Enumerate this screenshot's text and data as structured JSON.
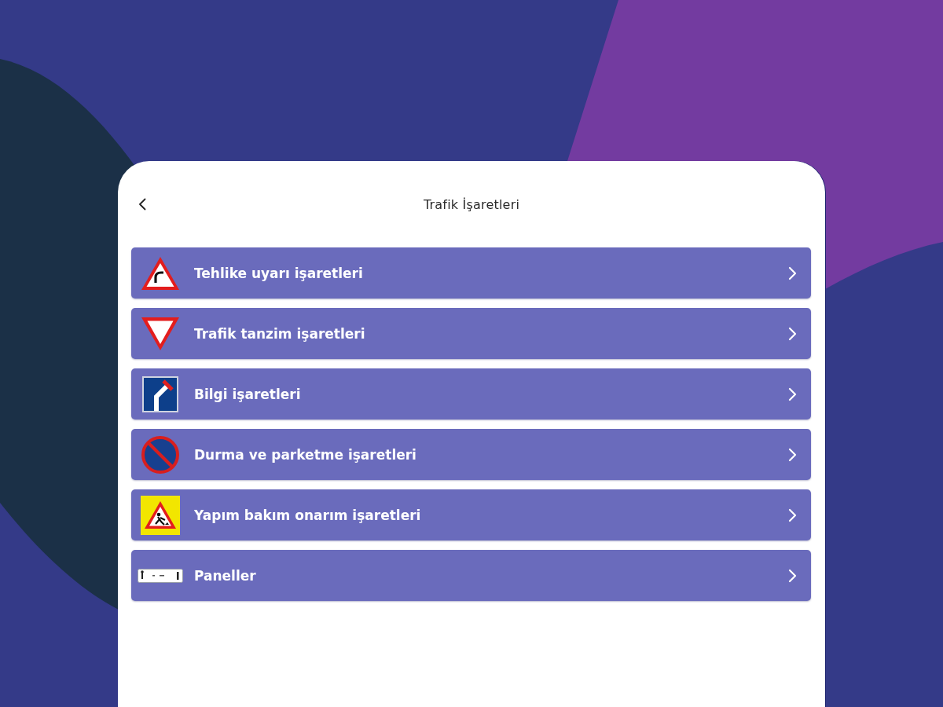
{
  "screen": {
    "title": "Trafik İşaretleri"
  },
  "categories": [
    {
      "kind": "warning",
      "label": "Tehlike uyarı işaretleri"
    },
    {
      "kind": "regulatory",
      "label": "Trafik tanzim işaretleri"
    },
    {
      "kind": "info",
      "label": "Bilgi işaretleri"
    },
    {
      "kind": "parking",
      "label": "Durma ve parketme işaretleri"
    },
    {
      "kind": "roadwork",
      "label": "Yapım bakım onarım işaretleri"
    },
    {
      "kind": "panel",
      "label": "Paneller"
    }
  ]
}
